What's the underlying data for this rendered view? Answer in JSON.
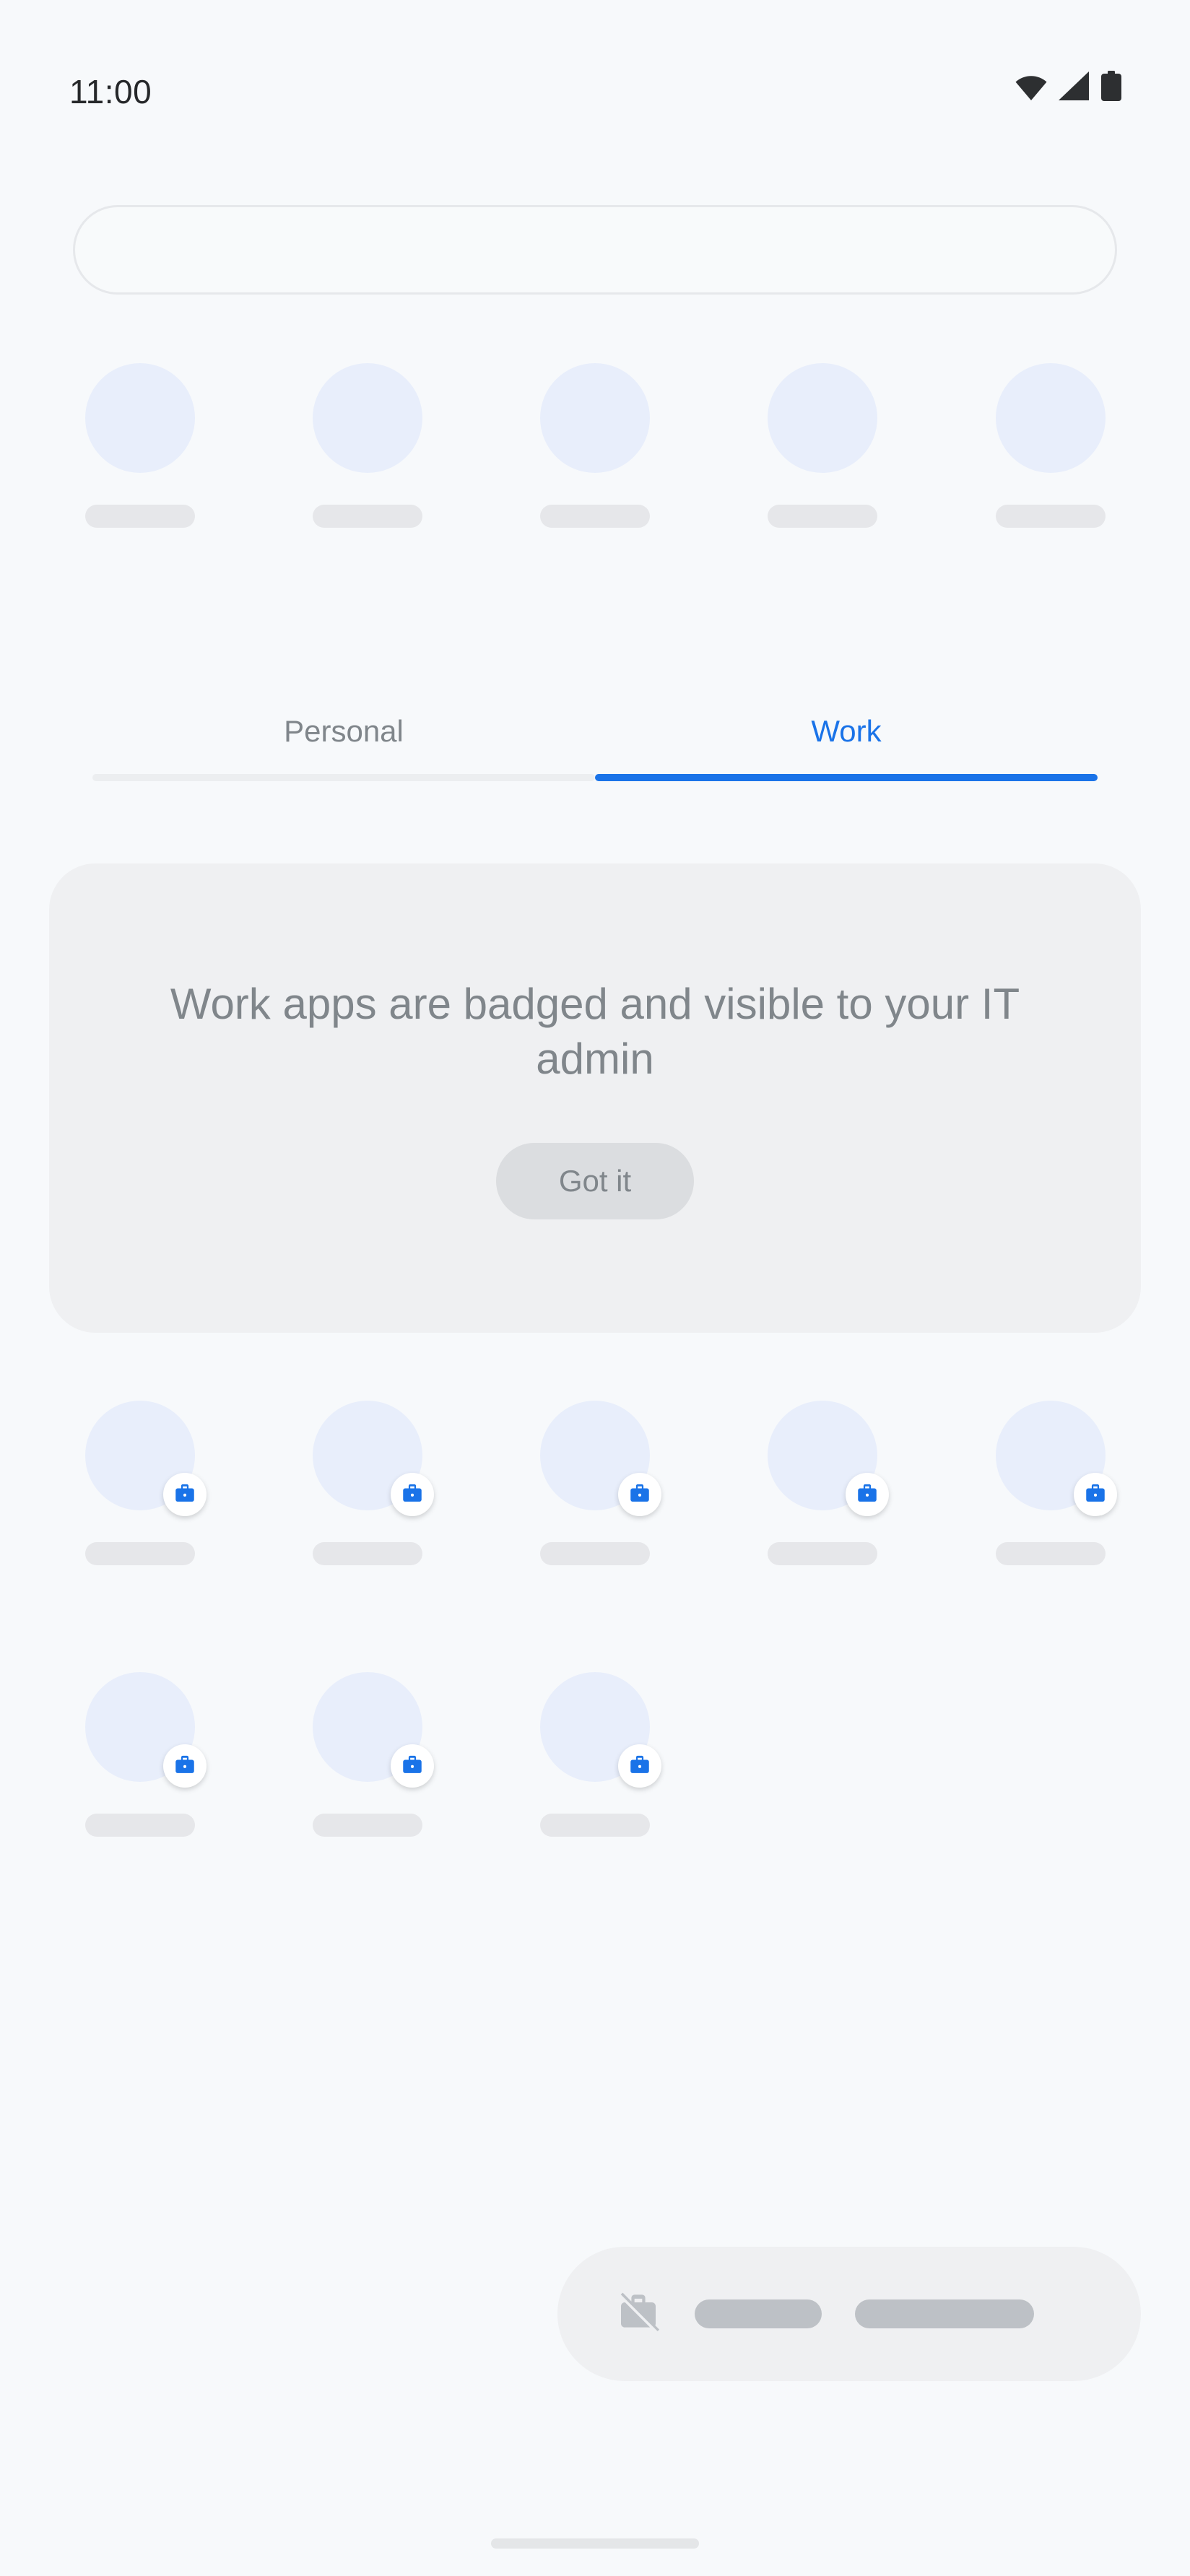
{
  "status_bar": {
    "time": "11:00",
    "icons": [
      {
        "name": "wifi-icon",
        "label": "Wi-Fi"
      },
      {
        "name": "cellular-signal-icon",
        "label": "Cellular signal"
      },
      {
        "name": "battery-icon",
        "label": "Battery full"
      }
    ]
  },
  "search": {
    "value": "",
    "placeholder": ""
  },
  "tabs": [
    {
      "label": "Personal",
      "active": false
    },
    {
      "label": "Work",
      "active": true
    }
  ],
  "info_card": {
    "message": "Work apps are badged and visible to your IT admin",
    "button_label": "Got it"
  },
  "app_rows": {
    "top_suggestions": {
      "count": 5,
      "badged": false
    },
    "work_row_1": {
      "count": 5,
      "badged": true
    },
    "work_row_2": {
      "count": 3,
      "badged": true
    }
  },
  "work_bar": {
    "icon": "work-profile-off-icon",
    "placeholder_count": 2
  },
  "colors": {
    "page_background": "#f7f9fb",
    "accent_blue": "#1a73e8",
    "badge_blue": "#1a73e8",
    "icon_skeleton": "#e8eefb",
    "label_skeleton": "#e6e7ea",
    "card_background": "#eff0f2",
    "inactive_tab_text": "#80868b",
    "button_background": "#dbdde0",
    "bar_placeholder": "#bdc1c6",
    "status_icon": "#26282a"
  },
  "nav_handle": {
    "present": true
  }
}
